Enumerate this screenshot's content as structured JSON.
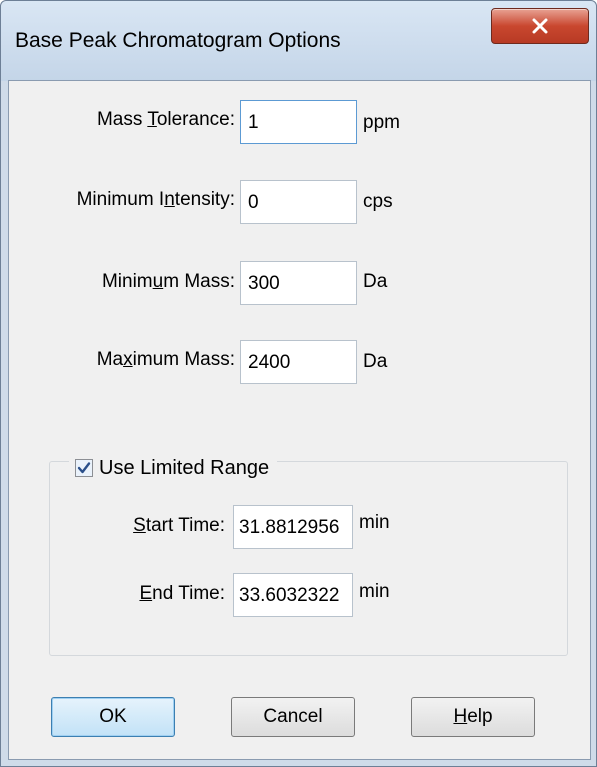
{
  "window": {
    "title": "Base Peak Chromatogram Options",
    "close_icon": "close-x-icon"
  },
  "fields": {
    "mass_tolerance": {
      "label_pre": "Mass ",
      "label_accel": "T",
      "label_post": "olerance:",
      "value": "1",
      "unit": "ppm"
    },
    "minimum_intensity": {
      "label_pre": "Minimum I",
      "label_accel": "n",
      "label_post": "tensity:",
      "value": "0",
      "unit": "cps"
    },
    "minimum_mass": {
      "label_pre": "Minim",
      "label_accel": "u",
      "label_post": "m Mass:",
      "value": "300",
      "unit": "Da"
    },
    "maximum_mass": {
      "label_pre": "Ma",
      "label_accel": "x",
      "label_post": "imum Mass:",
      "value": "2400",
      "unit": "Da"
    }
  },
  "limited_range": {
    "label": "Use Limited Range",
    "checked": true,
    "start_time": {
      "label_pre": "",
      "label_accel": "S",
      "label_post": "tart Time:",
      "value": "31.8812956",
      "unit": "min"
    },
    "end_time": {
      "label_pre": "",
      "label_accel": "E",
      "label_post": "nd Time:",
      "value": "33.6032322",
      "unit": "min"
    }
  },
  "buttons": {
    "ok": "OK",
    "cancel": "Cancel",
    "help_accel": "H",
    "help_post": "elp"
  },
  "colors": {
    "title_bar": "#c4d5e8",
    "close_button": "#c9472f",
    "default_button": "#c2e2f7",
    "focus_border": "#5c9ad3"
  }
}
